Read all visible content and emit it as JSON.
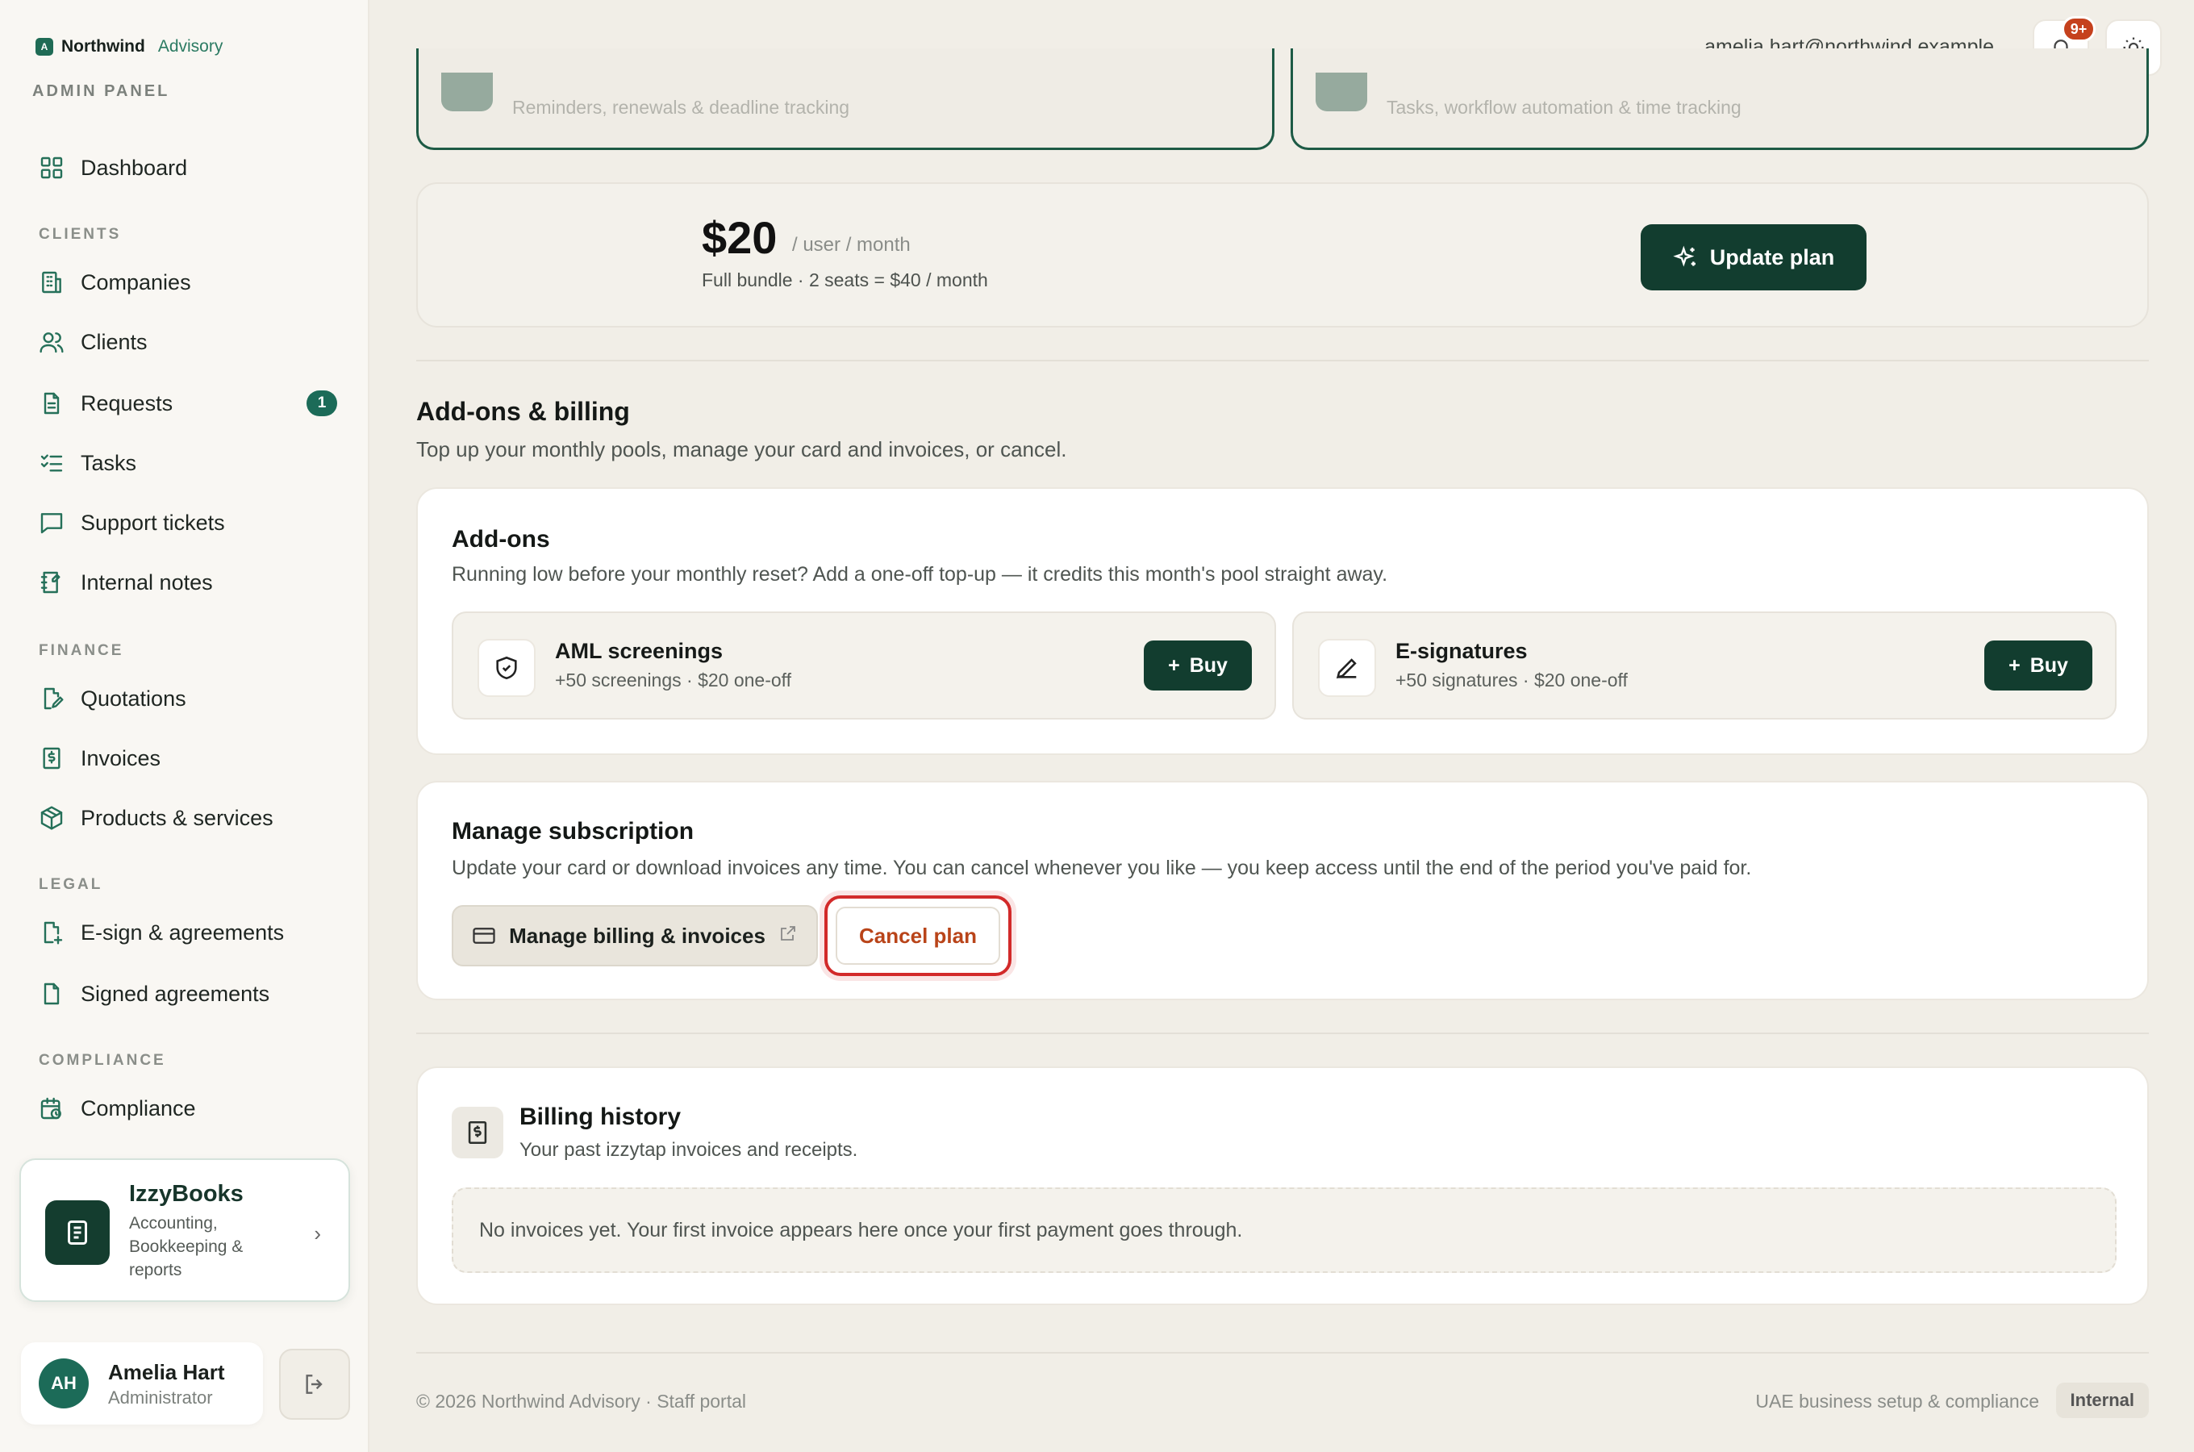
{
  "brand": {
    "mark": "A",
    "name": "Northwind",
    "sub": "Advisory"
  },
  "sidebar": {
    "admin_label": "ADMIN PANEL",
    "sections": {
      "clients": "CLIENTS",
      "finance": "FINANCE",
      "legal": "LEGAL",
      "compliance": "COMPLIANCE"
    },
    "items": {
      "dashboard": "Dashboard",
      "companies": "Companies",
      "clients": "Clients",
      "requests": "Requests",
      "requests_badge": "1",
      "tasks": "Tasks",
      "support": "Support tickets",
      "notes": "Internal notes",
      "quotations": "Quotations",
      "invoices": "Invoices",
      "products": "Products & services",
      "esign": "E-sign & agreements",
      "signed": "Signed agreements",
      "compliance": "Compliance"
    },
    "promo": {
      "title": "IzzyBooks",
      "subtitle": "Accounting, Bookkeeping & reports"
    },
    "user": {
      "initials": "AH",
      "name": "Amelia Hart",
      "role": "Administrator"
    }
  },
  "topbar": {
    "email": "amelia.hart@northwind.example",
    "notif_count": "9+"
  },
  "modules": {
    "left_text": "Reminders, renewals & deadline tracking",
    "right_text": "Tasks, workflow automation & time tracking"
  },
  "plan": {
    "price": "$20",
    "unit": "/ user / month",
    "summary": "Full bundle · 2 seats = $40 / month",
    "update_label": "Update plan"
  },
  "billing": {
    "title": "Add-ons & billing",
    "subtitle": "Top up your monthly pools, manage your card and invoices, or cancel."
  },
  "addons": {
    "title": "Add-ons",
    "subtitle": "Running low before your monthly reset? Add a one-off top-up — it credits this month's pool straight away.",
    "items": [
      {
        "title": "AML screenings",
        "sub": "+50 screenings · $20 one-off",
        "buy": "Buy"
      },
      {
        "title": "E-signatures",
        "sub": "+50 signatures · $20 one-off",
        "buy": "Buy"
      }
    ]
  },
  "subscription": {
    "title": "Manage subscription",
    "subtitle": "Update your card or download invoices any time. You can cancel whenever you like — you keep access until the end of the period you've paid for.",
    "manage_label": "Manage billing & invoices",
    "cancel_label": "Cancel plan"
  },
  "history": {
    "title": "Billing history",
    "subtitle": "Your past izzytap invoices and receipts.",
    "empty": "No invoices yet. Your first invoice appears here once your first payment goes through."
  },
  "footer": {
    "copyright": "© 2026 Northwind Advisory · Staff portal",
    "tagline": "UAE business setup & compliance",
    "tag": "Internal"
  }
}
